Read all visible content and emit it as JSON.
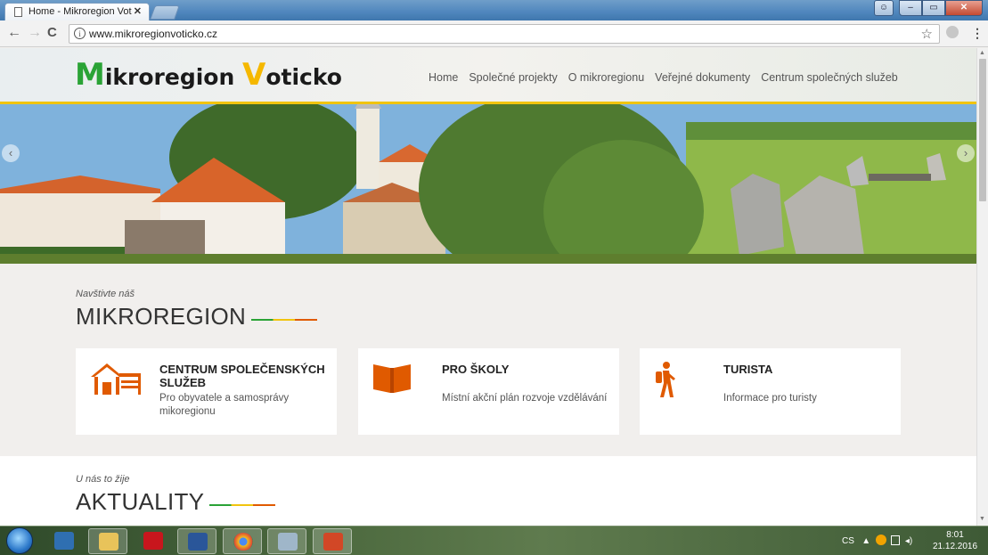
{
  "browser": {
    "tab_title": "Home - Mikroregion Vot",
    "tab_close": "✕",
    "url": "www.mikroregionvoticko.cz",
    "info_glyph": "i",
    "back_glyph": "←",
    "forward_glyph": "→",
    "reload_glyph": "C",
    "star_glyph": "☆",
    "menu_glyph": "⋮"
  },
  "window_controls": {
    "minimize": "–",
    "restore": "▭",
    "close": "✕"
  },
  "site": {
    "logo_text": "ikroregion ",
    "logo_m": "M",
    "logo_v": "V",
    "logo_rest": "oticko",
    "brand_colors": {
      "green": "#2aa336",
      "yellow": "#f1c40f",
      "orange": "#e05a00"
    },
    "nav": [
      {
        "label": "Home"
      },
      {
        "label": "Společné projekty"
      },
      {
        "label": "O mikroregionu"
      },
      {
        "label": "Veřejné dokumenty"
      },
      {
        "label": "Centrum společných služeb"
      }
    ],
    "hero_prev": "‹",
    "hero_next": "›"
  },
  "section_region": {
    "eyebrow": "Navštivte náš",
    "title": "MIKROREGION",
    "cards": [
      {
        "icon": "house-garage-icon",
        "title": "CENTRUM SPOLEČENSKÝCH SLUŽEB",
        "desc": "Pro obyvatele a samosprávy mikoregionu"
      },
      {
        "icon": "book-icon",
        "title": "PRO ŠKOLY",
        "desc": "Místní akční plán rozvoje vzdělávání"
      },
      {
        "icon": "hiker-icon",
        "title": "TURISTA",
        "desc": "Informace pro turisty"
      }
    ]
  },
  "section_news": {
    "eyebrow": "U nás to žije",
    "title": "AKTUALITY"
  },
  "taskbar": {
    "apps": [
      "explorer-icon",
      "file-manager-icon",
      "acrobat-icon",
      "word-icon",
      "chrome-icon",
      "library-icon",
      "powerpoint-icon"
    ],
    "language": "CS",
    "tray_arrow": "▲",
    "time": "8:01",
    "date": "21.12.2016"
  }
}
